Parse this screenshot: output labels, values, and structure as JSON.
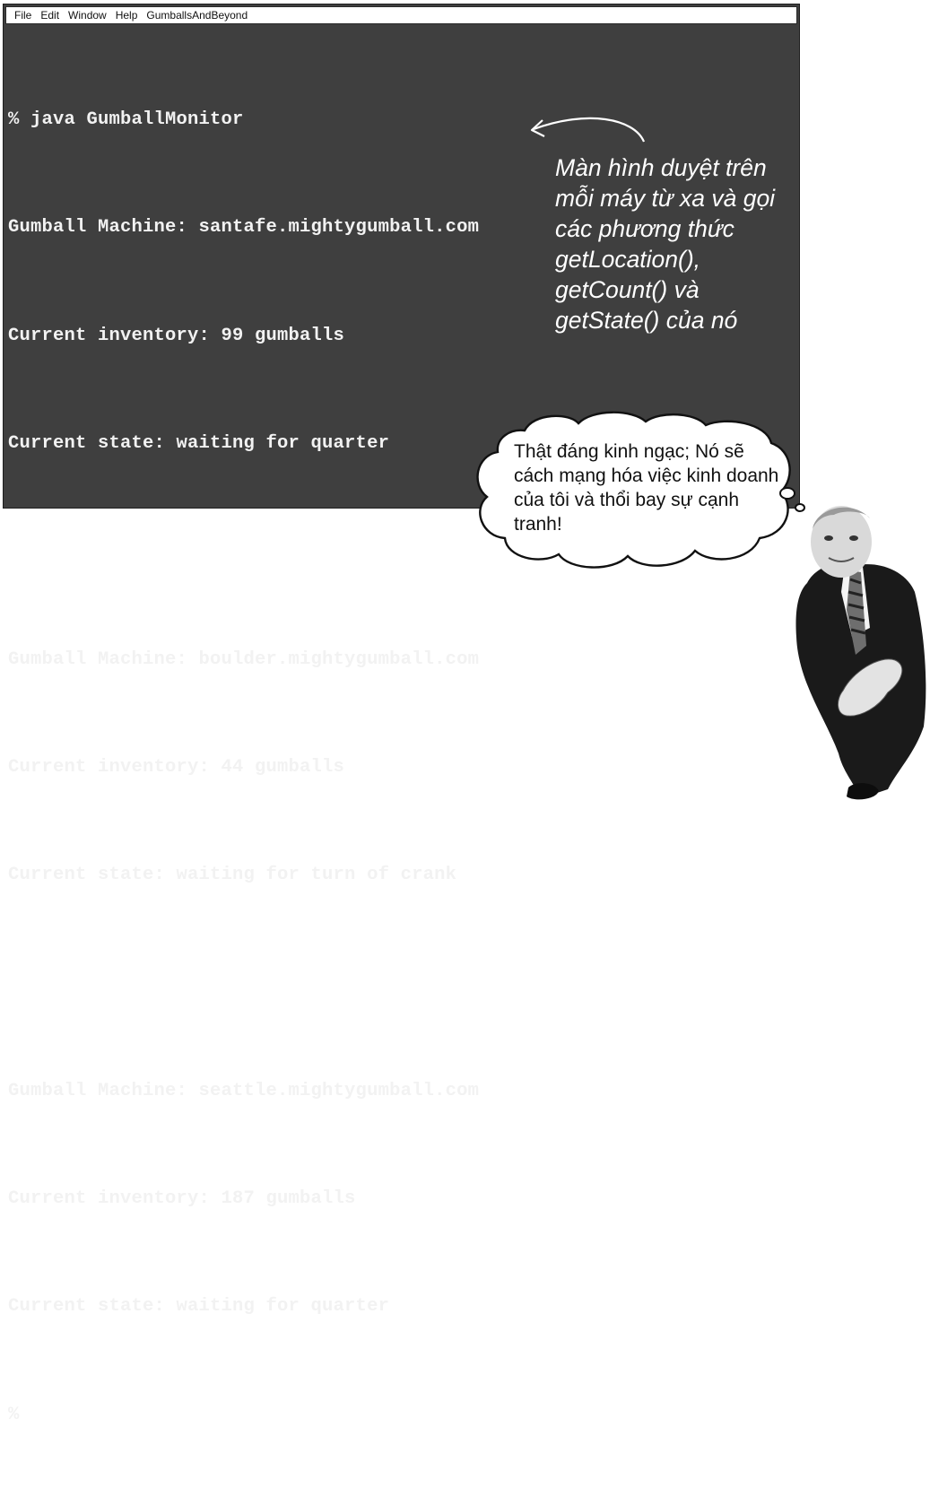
{
  "menu": [
    "File",
    "Edit",
    "Window",
    "Help",
    "GumballsAndBeyond"
  ],
  "terminal": {
    "lines": [
      "% java GumballMonitor",
      "Gumball Machine: santafe.mightygumball.com",
      "Current inventory: 99 gumballs",
      "Current state: waiting for quarter",
      "",
      "Gumball Machine: boulder.mightygumball.com",
      "Current inventory: 44 gumballs",
      "Current state: waiting for turn of crank",
      "",
      "Gumball Machine: seattle.mightygumball.com",
      "Current inventory: 187 gumballs",
      "Current state: waiting for quarter",
      "%"
    ]
  },
  "annotation": {
    "text": "Màn hình duyệt trên mỗi máy từ xa và gọi các phương thức getLocation(), getCount() và getState() của nó"
  },
  "bubble": {
    "text": "Thật đáng kinh ngạc; Nó sẽ cách mạng hóa việc kinh doanh của tôi và thổi bay sự cạnh tranh!"
  },
  "colors": {
    "terminal_bg": "#3f3f3f",
    "terminal_text": "#f2f2f2",
    "menubar_bg": "#ffffff"
  }
}
